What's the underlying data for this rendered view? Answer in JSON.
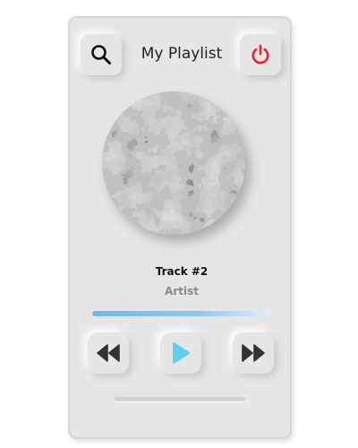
{
  "header": {
    "title": "My Playlist",
    "search_icon": "search-icon",
    "power_icon": "power-icon",
    "power_color": "#e8212b"
  },
  "now_playing": {
    "track_title": "Track #2",
    "artist": "Artist",
    "progress": 1.0,
    "cover_icon": "album-cover"
  },
  "controls": {
    "prev_icon": "rewind-icon",
    "play_icon": "play-icon",
    "next_icon": "fast-forward-icon",
    "play_color": "#5bd0f0"
  },
  "colors": {
    "accent": "#5bd0f0",
    "progress": "#73b8ea",
    "surface": "#e6e6e6"
  }
}
